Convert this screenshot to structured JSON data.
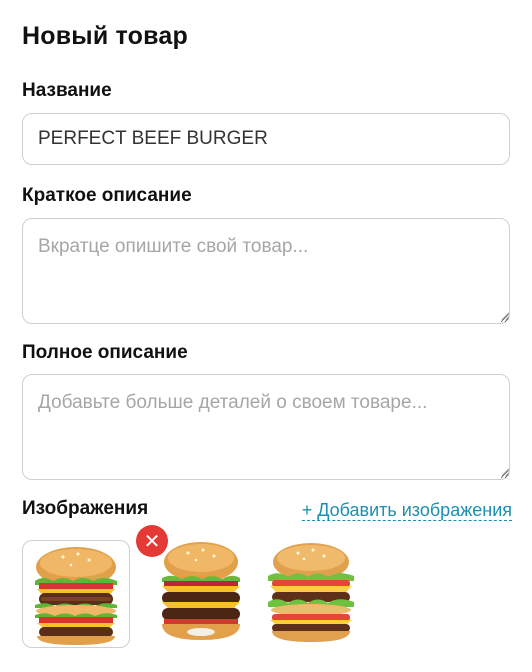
{
  "page_title": "Новый товар",
  "fields": {
    "name": {
      "label": "Название",
      "value": "PERFECT BEEF BURGER"
    },
    "short_description": {
      "label": "Краткое описание",
      "placeholder": "Вкратце опишите свой товар..."
    },
    "full_description": {
      "label": "Полное описание",
      "placeholder": "Добавьте больше деталей о своем товаре..."
    }
  },
  "images": {
    "label": "Изображения",
    "add_link": "+ Добавить изображения",
    "remove_icon": "close-icon",
    "items": [
      "burger-image-1",
      "burger-image-2",
      "burger-image-3"
    ]
  },
  "colors": {
    "accent_link": "#1c8fb0",
    "remove_button": "#e53935",
    "border": "#cfcfcf"
  }
}
